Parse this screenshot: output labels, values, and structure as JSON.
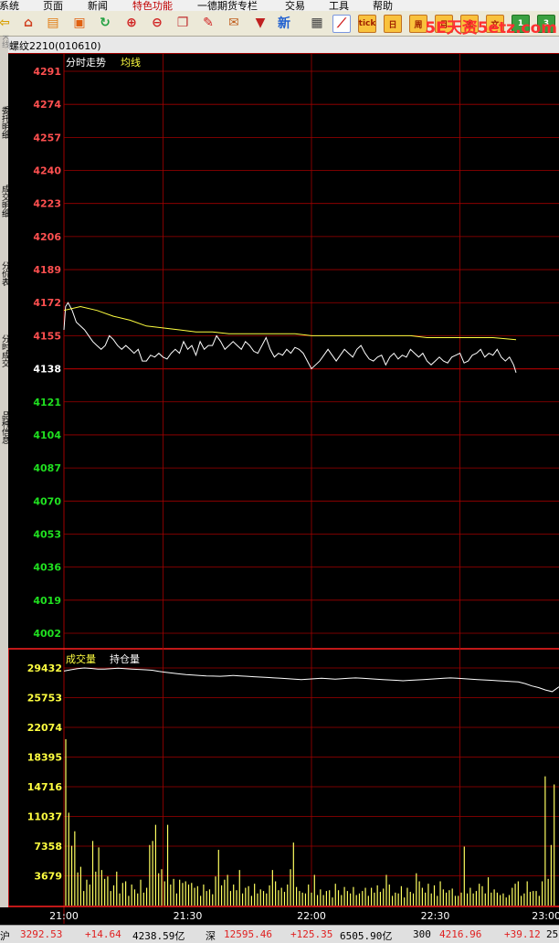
{
  "menu": [
    {
      "label": "系统",
      "selected": false
    },
    {
      "label": "页面",
      "selected": false
    },
    {
      "label": "新闻",
      "selected": false
    },
    {
      "label": "特色功能",
      "selected": true
    },
    {
      "label": "一德期货专栏",
      "selected": false
    },
    {
      "label": "交易",
      "selected": false
    },
    {
      "label": "工具",
      "selected": false
    },
    {
      "label": "帮助",
      "selected": false
    }
  ],
  "toolbar": {
    "buttons": [
      {
        "name": "back-icon",
        "glyph": "⇦",
        "color": "#d8a000"
      },
      {
        "name": "home-icon",
        "glyph": "⌂",
        "color": "#d04020"
      },
      {
        "name": "database-icon",
        "glyph": "▤",
        "color": "#e07a10"
      },
      {
        "name": "news-icon",
        "glyph": "▣",
        "color": "#e06010"
      },
      {
        "name": "refresh-icon",
        "glyph": "↻",
        "color": "#20a040"
      },
      {
        "name": "zoom-in-icon",
        "glyph": "⊕",
        "color": "#d02020"
      },
      {
        "name": "zoom-out-icon",
        "glyph": "⊖",
        "color": "#d02020"
      },
      {
        "name": "window-icon",
        "glyph": "❐",
        "color": "#c03030"
      },
      {
        "name": "pen-icon",
        "glyph": "✎",
        "color": "#d02020"
      },
      {
        "name": "stamp-icon",
        "glyph": "✉",
        "color": "#c06020"
      },
      {
        "name": "filter-icon",
        "glyph": "▼",
        "color": "#c02020"
      },
      {
        "name": "new-icon",
        "glyph": "新",
        "color": "#2060d0"
      },
      {
        "name": "table-icon",
        "glyph": "▦",
        "color": "#404040"
      },
      {
        "name": "chart-icon",
        "glyph": "⟋",
        "color": "#d02020"
      }
    ],
    "period_buttons": [
      "tick",
      "日",
      "周",
      "月",
      "季",
      "文",
      "1",
      "3"
    ],
    "logo": "5E天资5etz.com"
  },
  "contract": {
    "title": "螺纹2210(010610)"
  },
  "side_tabs": [
    "K线",
    "委托明细",
    "成交明细",
    "分价表",
    "分时成交",
    "品种信息"
  ],
  "chart_data": [
    {
      "type": "line",
      "legend_labels": [
        "分时走势",
        "均线"
      ],
      "series": [
        {
          "name": "分时走势",
          "color": "#ffffff",
          "points": [
            [
              0,
              4158
            ],
            [
              2,
              4170
            ],
            [
              5,
              4172
            ],
            [
              10,
              4168
            ],
            [
              15,
              4162
            ],
            [
              20,
              4160
            ],
            [
              25,
              4158
            ],
            [
              30,
              4155
            ],
            [
              35,
              4152
            ],
            [
              40,
              4150
            ],
            [
              45,
              4148
            ],
            [
              50,
              4150
            ],
            [
              55,
              4155
            ],
            [
              60,
              4153
            ],
            [
              65,
              4150
            ],
            [
              70,
              4148
            ],
            [
              75,
              4150
            ],
            [
              80,
              4148
            ],
            [
              85,
              4146
            ],
            [
              90,
              4148
            ],
            [
              95,
              4142
            ],
            [
              100,
              4142
            ],
            [
              105,
              4145
            ],
            [
              110,
              4144
            ],
            [
              115,
              4146
            ],
            [
              120,
              4144
            ],
            [
              125,
              4143
            ],
            [
              130,
              4146
            ],
            [
              135,
              4148
            ],
            [
              140,
              4146
            ],
            [
              145,
              4152
            ],
            [
              150,
              4148
            ],
            [
              155,
              4150
            ],
            [
              160,
              4145
            ],
            [
              165,
              4152
            ],
            [
              170,
              4148
            ],
            [
              175,
              4150
            ],
            [
              180,
              4150
            ],
            [
              185,
              4155
            ],
            [
              190,
              4152
            ],
            [
              195,
              4148
            ],
            [
              200,
              4150
            ],
            [
              205,
              4152
            ],
            [
              210,
              4150
            ],
            [
              215,
              4148
            ],
            [
              220,
              4152
            ],
            [
              225,
              4150
            ],
            [
              230,
              4147
            ],
            [
              235,
              4146
            ],
            [
              240,
              4150
            ],
            [
              245,
              4154
            ],
            [
              250,
              4148
            ],
            [
              255,
              4144
            ],
            [
              260,
              4146
            ],
            [
              265,
              4145
            ],
            [
              270,
              4148
            ],
            [
              275,
              4146
            ],
            [
              280,
              4149
            ],
            [
              285,
              4148
            ],
            [
              290,
              4146
            ],
            [
              295,
              4142
            ],
            [
              300,
              4138
            ],
            [
              305,
              4140
            ],
            [
              310,
              4142
            ],
            [
              315,
              4145
            ],
            [
              320,
              4148
            ],
            [
              325,
              4145
            ],
            [
              330,
              4142
            ],
            [
              335,
              4145
            ],
            [
              340,
              4148
            ],
            [
              345,
              4146
            ],
            [
              350,
              4144
            ],
            [
              355,
              4148
            ],
            [
              360,
              4150
            ],
            [
              365,
              4146
            ],
            [
              370,
              4143
            ],
            [
              375,
              4142
            ],
            [
              380,
              4144
            ],
            [
              385,
              4145
            ],
            [
              390,
              4140
            ],
            [
              395,
              4144
            ],
            [
              400,
              4146
            ],
            [
              405,
              4143
            ],
            [
              410,
              4145
            ],
            [
              415,
              4144
            ],
            [
              420,
              4148
            ],
            [
              425,
              4146
            ],
            [
              430,
              4144
            ],
            [
              435,
              4146
            ],
            [
              440,
              4142
            ],
            [
              445,
              4140
            ],
            [
              450,
              4142
            ],
            [
              455,
              4144
            ],
            [
              460,
              4142
            ],
            [
              465,
              4141
            ],
            [
              470,
              4144
            ],
            [
              475,
              4145
            ],
            [
              480,
              4146
            ],
            [
              485,
              4141
            ],
            [
              490,
              4142
            ],
            [
              495,
              4145
            ],
            [
              500,
              4146
            ],
            [
              505,
              4148
            ],
            [
              510,
              4144
            ],
            [
              515,
              4146
            ],
            [
              520,
              4145
            ],
            [
              525,
              4148
            ],
            [
              530,
              4144
            ],
            [
              535,
              4142
            ],
            [
              540,
              4144
            ],
            [
              545,
              4140
            ],
            [
              548,
              4136
            ]
          ]
        },
        {
          "name": "均线",
          "color": "#ffff40",
          "points": [
            [
              0,
              4168
            ],
            [
              20,
              4170
            ],
            [
              40,
              4168
            ],
            [
              60,
              4165
            ],
            [
              80,
              4163
            ],
            [
              100,
              4160
            ],
            [
              120,
              4159
            ],
            [
              140,
              4158
            ],
            [
              160,
              4157
            ],
            [
              180,
              4157
            ],
            [
              200,
              4156
            ],
            [
              220,
              4156
            ],
            [
              240,
              4156
            ],
            [
              260,
              4156
            ],
            [
              280,
              4156
            ],
            [
              300,
              4155
            ],
            [
              320,
              4155
            ],
            [
              340,
              4155
            ],
            [
              360,
              4155
            ],
            [
              380,
              4155
            ],
            [
              400,
              4155
            ],
            [
              420,
              4155
            ],
            [
              440,
              4154
            ],
            [
              460,
              4154
            ],
            [
              480,
              4154
            ],
            [
              500,
              4154
            ],
            [
              520,
              4154
            ],
            [
              548,
              4153
            ]
          ]
        }
      ],
      "y_ticks": [
        4291,
        4274,
        4257,
        4240,
        4223,
        4206,
        4189,
        4172,
        4155,
        4138,
        4121,
        4104,
        4087,
        4070,
        4053,
        4036,
        4019,
        4002
      ],
      "reference_price": 4138,
      "ylim": [
        4002,
        4291
      ],
      "x_ticks": [
        "21:00",
        "21:30",
        "22:00",
        "22:30",
        "23:00"
      ],
      "grid": true
    },
    {
      "type": "bar",
      "legend_labels": [
        "成交量",
        "持仓量"
      ],
      "y_ticks": [
        29432,
        25753,
        22074,
        18395,
        14716,
        11037,
        7358,
        3679
      ],
      "ylim": [
        0,
        29432
      ],
      "volume_bars": [
        20600,
        11500,
        7400,
        9200,
        4100,
        4800,
        1800,
        3200,
        2600,
        8000,
        4200,
        7200,
        4400,
        3300,
        3600,
        1800,
        2500,
        4200,
        1500,
        2800,
        3000,
        1200,
        2600,
        2000,
        1500,
        3200,
        1600,
        2200,
        7500,
        8000,
        10000,
        4000,
        4500,
        3000,
        10000,
        2600,
        3300,
        1500,
        3200,
        2800,
        3000,
        2600,
        2800,
        2200,
        2400,
        1200,
        2600,
        1800,
        2000,
        1400,
        3600,
        6900,
        2500,
        3200,
        3800,
        1800,
        2600,
        1900,
        4400,
        1500,
        2200,
        2400,
        1200,
        2700,
        1500,
        2000,
        1800,
        1500,
        2500,
        4400,
        3000,
        1900,
        2200,
        1700,
        2600,
        4500,
        7800,
        2300,
        1800,
        1600,
        1500,
        2600,
        1600,
        3800,
        1300,
        2000,
        1300,
        1800,
        1900,
        1000,
        2700,
        1900,
        1300,
        2300,
        1800,
        1500,
        2300,
        1300,
        1500,
        1800,
        2200,
        1200,
        2200,
        1600,
        2500,
        1700,
        2100,
        3800,
        2600,
        1200,
        1600,
        1500,
        2400,
        1000,
        2200,
        1700,
        1500,
        4000,
        3000,
        2200,
        1600,
        2700,
        1500,
        2500,
        1200,
        3000,
        2000,
        1600,
        1900,
        2100,
        1200,
        1200,
        1600,
        7300,
        1500,
        2200,
        1500,
        1800,
        2700,
        2400,
        1500,
        3500,
        1600,
        2000,
        1600,
        1300,
        1500,
        1000,
        1300,
        2200,
        2700,
        3000,
        1200,
        1500,
        3000,
        1700,
        1800,
        1800,
        1200,
        3000,
        16000,
        3300,
        7500,
        15000
      ],
      "open_interest": [
        29050,
        29200,
        29350,
        29430,
        29380,
        29300,
        29300,
        29350,
        29400,
        29350,
        29300,
        29250,
        29200,
        29150,
        29000,
        28900,
        28800,
        28700,
        28600,
        28550,
        28500,
        28450,
        28420,
        28400,
        28450,
        28500,
        28450,
        28400,
        28350,
        28300,
        28250,
        28200,
        28150,
        28100,
        28050,
        28000,
        28050,
        28100,
        28150,
        28100,
        28050,
        28100,
        28150,
        28200,
        28150,
        28100,
        28050,
        28000,
        27950,
        27900,
        27850,
        27900,
        27950,
        28000,
        28050,
        28100,
        28150,
        28200,
        28150,
        28100,
        28050,
        28000,
        27950,
        27900,
        27850,
        27800,
        27750,
        27700,
        27500,
        27200,
        27000,
        26700,
        26500,
        27100
      ],
      "grid": true
    }
  ],
  "market": {
    "sh_label": "沪",
    "sh_index": "3292.53",
    "sh_change": "+14.64",
    "sh_amount": "4238.59亿",
    "sz_label": "深",
    "sz_index": "12595.46",
    "sz_change": "+125.35",
    "sz_amount": "6505.90亿",
    "c300_label": "300",
    "c300_index": "4216.96",
    "c300_change": "+39.12",
    "c300_tail": "25"
  },
  "colors": {
    "price_up": "#ff5050",
    "price_down": "#20e020",
    "reference": "#ffffff",
    "grid_red": "#a00000",
    "volume_axis": "#ffff40",
    "volume_bar": "#ffff60",
    "price_line": "#ffffff",
    "avg_line": "#ffff40"
  }
}
